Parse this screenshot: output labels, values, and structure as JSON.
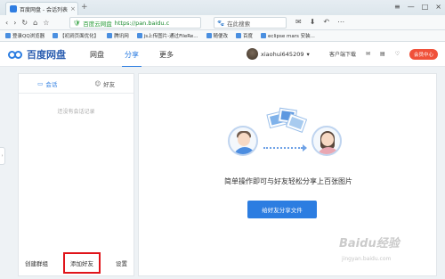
{
  "browser": {
    "tab_title": "百度网盘 - 会话列表",
    "tab_close": "×",
    "new_tab": "+",
    "window_controls": [
      "≡",
      "—",
      "□",
      "×"
    ],
    "nav_icons": [
      "‹",
      "›",
      "↻",
      "⌂",
      "☆"
    ],
    "secure_label": "百度云网盘",
    "url": "https://pan.baidu.c",
    "search_placeholder": "在此搜索",
    "toolbar_icons": [
      "✉",
      "⬇",
      "↶",
      "⋯"
    ]
  },
  "bookmarks": [
    "登录QQ浏览器",
    "【初涧页面优化】",
    "腾讯网",
    "js上传图片-通过FileRe...",
    "随便改",
    "百度",
    "eclipse mars 安装..."
  ],
  "header": {
    "logo_text": "百度网盘",
    "nav": [
      "网盘",
      "分享",
      "更多"
    ],
    "active_nav": "分享",
    "username": "xiaohui645209",
    "client_download": "客户端下载",
    "vip_button": "会员中心"
  },
  "left_panel": {
    "tabs": [
      "会话",
      "好友"
    ],
    "empty_text": "还没有会话记录",
    "footer": {
      "create_group": "创建群组",
      "add_friend": "添加好友",
      "settings": "设置"
    }
  },
  "main": {
    "headline": "简单操作即可与好友轻松分享上百张图片",
    "share_button": "给好友分享文件"
  },
  "watermark": {
    "text": "Baidu经验",
    "sub": "jingyan.baidu.com"
  },
  "colors": {
    "accent": "#2c7de1",
    "vip": "#f0513a",
    "highlight_border": "#e0141a"
  }
}
